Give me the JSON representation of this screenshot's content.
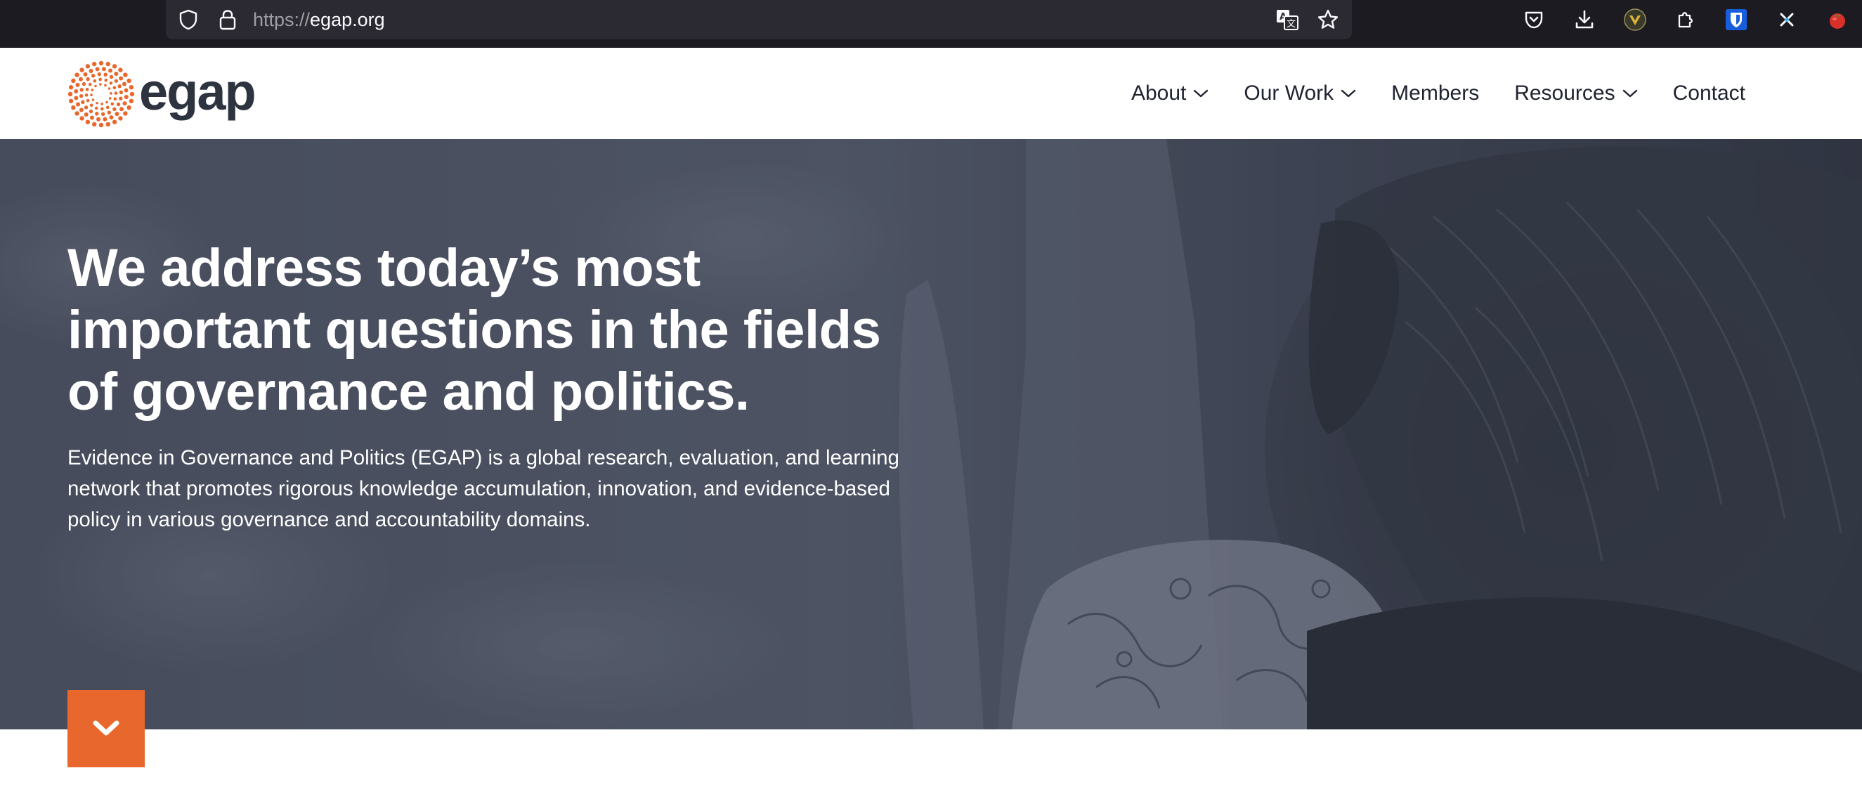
{
  "browser": {
    "url_protocol": "https://",
    "url_domain": "egap.org",
    "icons": [
      "shield-icon",
      "lock-icon",
      "translate-icon",
      "bookmark-star-icon",
      "pocket-icon",
      "download-icon",
      "extension-avatar-icon",
      "extensions-puzzle-icon",
      "bitwarden-icon",
      "close-x-icon",
      "tomato-icon"
    ]
  },
  "header": {
    "logo_text": "egap",
    "nav": [
      {
        "label": "About",
        "has_dropdown": true
      },
      {
        "label": "Our Work",
        "has_dropdown": true
      },
      {
        "label": "Members",
        "has_dropdown": false
      },
      {
        "label": "Resources",
        "has_dropdown": true
      },
      {
        "label": "Contact",
        "has_dropdown": false
      }
    ]
  },
  "hero": {
    "title": "We address today’s most important questions in the fields of governance and politics.",
    "description": "Evidence in Governance and Politics (EGAP) is a global research, evaluation, and learning network that promotes rigorous knowledge accumulation, innovation, and evidence-based policy in various governance and accountability domains.",
    "scroll_icon": "chevron-down-icon"
  },
  "colors": {
    "accent": "#e8672c",
    "text_dark": "#1f2330",
    "chrome_bg": "#1c1b22",
    "urlbar_bg": "#2b2a33",
    "hero_overlay": "#3b4150"
  }
}
